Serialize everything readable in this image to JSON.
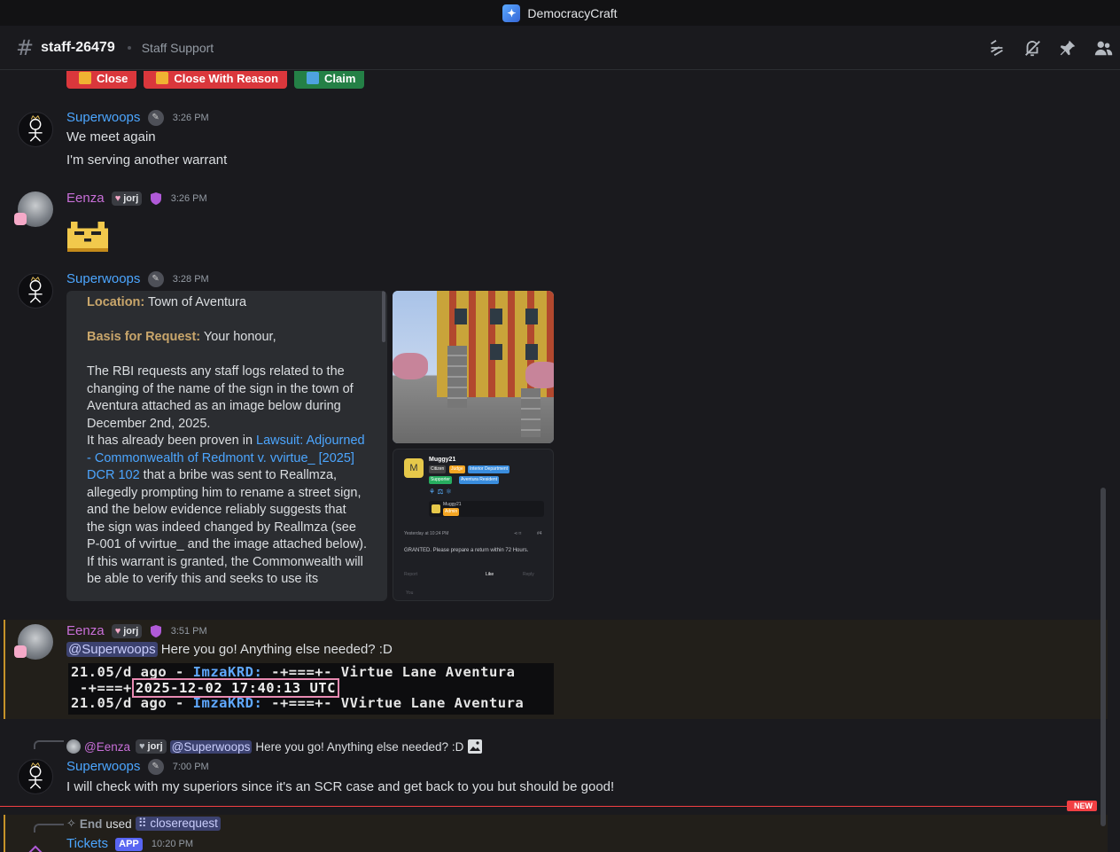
{
  "window": {
    "title": "DemocracyCraft"
  },
  "channel": {
    "name": "staff-26479",
    "topic": "Staff Support"
  },
  "header_icons": [
    "threads-icon",
    "mute-icon",
    "pin-icon",
    "members-icon"
  ],
  "buttons": [
    {
      "label": "Close",
      "color": "#da373c",
      "icon": "lock-icon"
    },
    {
      "label": "Close With Reason",
      "color": "#da373c",
      "icon": "lock-icon"
    },
    {
      "label": "Claim",
      "color": "#248046",
      "icon": "person-icon"
    }
  ],
  "messages": [
    {
      "author": "Superwoops",
      "time": "3:26 PM",
      "lines": [
        "We meet again",
        "I'm serving another warrant"
      ]
    },
    {
      "author": "Eenza",
      "tag": "jorj",
      "time": "3:26 PM",
      "sticker": "pixel-cat-emoji"
    },
    {
      "author": "Superwoops",
      "time": "3:28 PM",
      "embed": {
        "location_label": "Location:",
        "location_value": "Town of Aventura",
        "basis_label": "Basis for Request:",
        "basis_value": "Your honour,",
        "para1": "The RBI requests any staff logs related to the changing of the name of the sign in the town of Aventura attached as an image below during December 2nd, 2025.",
        "para2_a": "It has already been proven in ",
        "para2_link": "Lawsuit: Adjourned - Commonwealth of Redmont v. vvirtue_ [2025] DCR 102",
        "para2_b": " that a bribe was sent to Reallmza, allegedly prompting him to rename a street sign, and the below evidence reliably suggests that the sign was indeed changed by Reallmza (see P-001 of vvirtue_ and the image attached below). If this warrant is granted, the Commonwealth will be able to verify this and seeks to use its"
      },
      "screenshot": {
        "initial": "M",
        "name": "Muggy21",
        "role_chips": [
          "Citizen",
          "Judge",
          "Interior Department",
          "Supporter",
          "Aventura Resident"
        ],
        "sub_name": "Muggy21",
        "sub_chip": "Admin",
        "timestamp": "Yesterday at 10:24 PM",
        "post_num": "#4",
        "text": "GRANTED. Please prepare a return within 72 Hours.",
        "report": "Report",
        "like": "Like",
        "reply": "Reply",
        "you": "You"
      }
    },
    {
      "author": "Eenza",
      "tag": "jorj",
      "time": "3:51 PM",
      "mention": "@Superwoops",
      "text": "Here you go! Anything else needed? :D",
      "console": {
        "line1_a": "21.05/d ago - ",
        "line1_user": "ImzaKRD:",
        "line1_b": " -+===+- Virtue Lane Aventura",
        "line2_a": " -+===+",
        "line2_date": "2025-12-02 17:40:13 UTC",
        "line3_a": "21.05/d ago - ",
        "line3_user": "ImzaKRD:",
        "line3_b": " -+===+- VVirtue Lane Aventura"
      }
    },
    {
      "reply_to": {
        "author": "@Eenza",
        "tag": "jorj",
        "mention": "@Superwoops",
        "text": "Here you go! Anything else needed? :D"
      },
      "author": "Superwoops",
      "time": "7:00 PM",
      "text": "I will check with my superiors since it's an SCR case and get back to you but should be good!"
    },
    {
      "reply_to": {
        "user": "End",
        "verb": "used",
        "command": "closerequest"
      },
      "author": "Tickets",
      "app_tag": "APP",
      "time": "10:20 PM"
    }
  ],
  "new_label": "NEW"
}
